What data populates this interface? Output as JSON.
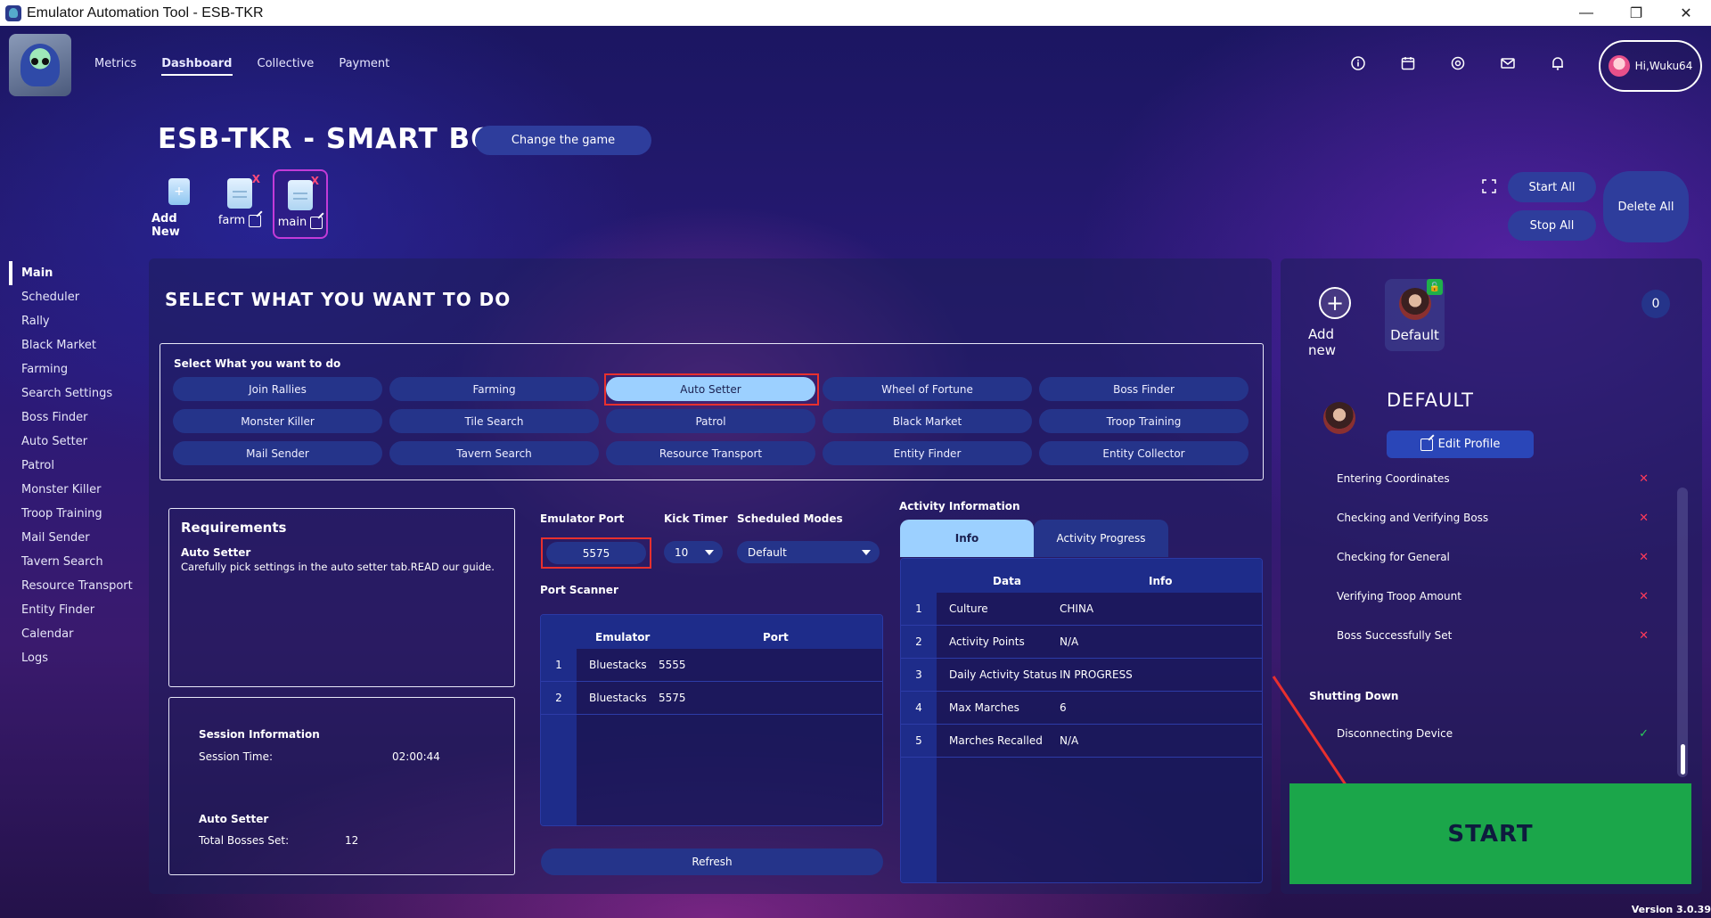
{
  "window": {
    "title": "Emulator Automation Tool - ESB-TKR",
    "minimize": "—",
    "restore": "❐",
    "close": "✕"
  },
  "nav": {
    "items": [
      "Metrics",
      "Dashboard",
      "Collective",
      "Payment"
    ],
    "active": "Dashboard"
  },
  "top_icons": [
    "info-icon",
    "calendar-icon",
    "settings-icon",
    "mail-icon",
    "bell-icon"
  ],
  "user": {
    "greeting": "Hi,Wuku64"
  },
  "header": {
    "title": "ESB-TKR - SMART BOT",
    "change_game": "Change the game"
  },
  "profiles": {
    "add_new": "Add New",
    "tabs": [
      {
        "label": "farm"
      },
      {
        "label": "main"
      }
    ],
    "selected": "main"
  },
  "controls": {
    "start_all": "Start All",
    "stop_all": "Stop All",
    "delete_all": "Delete All"
  },
  "sidebar": {
    "items": [
      "Main",
      "Scheduler",
      "Rally",
      "Black Market",
      "Farming",
      "Search Settings",
      "Boss Finder",
      "Auto Setter",
      "Patrol",
      "Monster Killer",
      "Troop Training",
      "Mail Sender",
      "Tavern Search",
      "Resource Transport",
      "Entity Finder",
      "Calendar",
      "Logs"
    ],
    "active": "Main"
  },
  "main": {
    "section_title": "SELECT WHAT YOU WANT TO DO",
    "task_box_title": "Select What you want to do",
    "tasks": [
      "Join Rallies",
      "Farming",
      "Auto Setter",
      "Wheel of Fortune",
      "Boss Finder",
      "Monster Killer",
      "Tile Search",
      "Patrol",
      "Black Market",
      "Troop Training",
      "Mail Sender",
      "Tavern Search",
      "Resource Transport",
      "Entity Finder",
      "Entity Collector"
    ],
    "selected_task": "Auto Setter"
  },
  "requirements": {
    "title": "Requirements",
    "subtitle": "Auto Setter",
    "text": "Carefully pick settings in the auto setter tab.READ our guide."
  },
  "session": {
    "header": "Session Information",
    "time_label": "Session Time:",
    "time_value": "02:00:44",
    "mode_header": "Auto Setter",
    "bosses_label": "Total Bosses Set:",
    "bosses_value": "12"
  },
  "emulator": {
    "port_label": "Emulator Port",
    "port_value": "5575",
    "kick_label": "Kick Timer",
    "kick_value": "10",
    "modes_label": "Scheduled Modes",
    "modes_value": "Default",
    "scanner_label": "Port Scanner",
    "scanner_columns": [
      "Emulator",
      "Port"
    ],
    "scanner_rows": [
      {
        "idx": "1",
        "emulator": "Bluestacks",
        "port": "5555"
      },
      {
        "idx": "2",
        "emulator": "Bluestacks",
        "port": "5575"
      }
    ],
    "refresh": "Refresh"
  },
  "activity": {
    "title": "Activity Information",
    "tabs": [
      "Info",
      "Activity Progress"
    ],
    "active_tab": "Info",
    "columns": [
      "Data",
      "Info"
    ],
    "rows": [
      {
        "idx": "1",
        "data": "Culture",
        "info": "CHINA"
      },
      {
        "idx": "2",
        "data": "Activity Points",
        "info": "N/A"
      },
      {
        "idx": "3",
        "data": "Daily Activity Status",
        "info": "IN PROGRESS"
      },
      {
        "idx": "4",
        "data": "Max Marches",
        "info": "6"
      },
      {
        "idx": "5",
        "data": "Marches Recalled",
        "info": "N/A"
      }
    ]
  },
  "right_panel": {
    "add_new": "Add new",
    "default_card": "Default",
    "count": "0",
    "profile_name": "DEFAULT",
    "edit_profile": "Edit Profile",
    "steps": [
      {
        "label": "Entering Coordinates",
        "status": "✕"
      },
      {
        "label": "Checking and Verifying Boss",
        "status": "✕"
      },
      {
        "label": "Checking for General",
        "status": "✕"
      },
      {
        "label": "Verifying Troop Amount",
        "status": "✕"
      },
      {
        "label": "Boss Successfully Set",
        "status": "✕"
      }
    ],
    "shutdown_header": "Shutting Down",
    "shutdown_steps": [
      {
        "label": "Disconnecting Device",
        "status": "✓"
      }
    ],
    "start": "START"
  },
  "version": "Version 3.0.39"
}
